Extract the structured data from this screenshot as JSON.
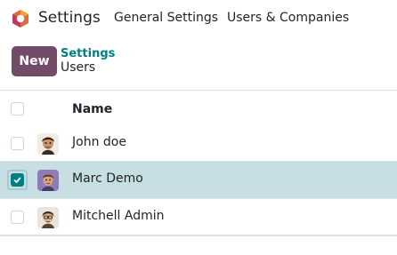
{
  "app": {
    "name": "Settings",
    "logo_icon": "odoo-hexagon-logo-icon",
    "logo_colors": [
      "#e16a3d",
      "#c2375a",
      "#f4a425"
    ]
  },
  "nav": {
    "items": [
      {
        "label": "General Settings"
      },
      {
        "label": "Users & Companies"
      }
    ]
  },
  "control_panel": {
    "new_label": "New",
    "breadcrumb": {
      "parent": "Settings",
      "current": "Users"
    }
  },
  "list": {
    "columns": [
      {
        "label": "Name"
      }
    ],
    "rows": [
      {
        "name": "John doe",
        "selected": false,
        "avatar_icon": "john-doe-avatar-icon"
      },
      {
        "name": "Marc Demo",
        "selected": true,
        "avatar_icon": "marc-demo-avatar-icon"
      },
      {
        "name": "Mitchell Admin",
        "selected": false,
        "avatar_icon": "mitchell-admin-avatar-icon"
      }
    ]
  },
  "colors": {
    "primary": "#714b67",
    "link": "#017e84",
    "selected_row": "#c7dfe3"
  }
}
